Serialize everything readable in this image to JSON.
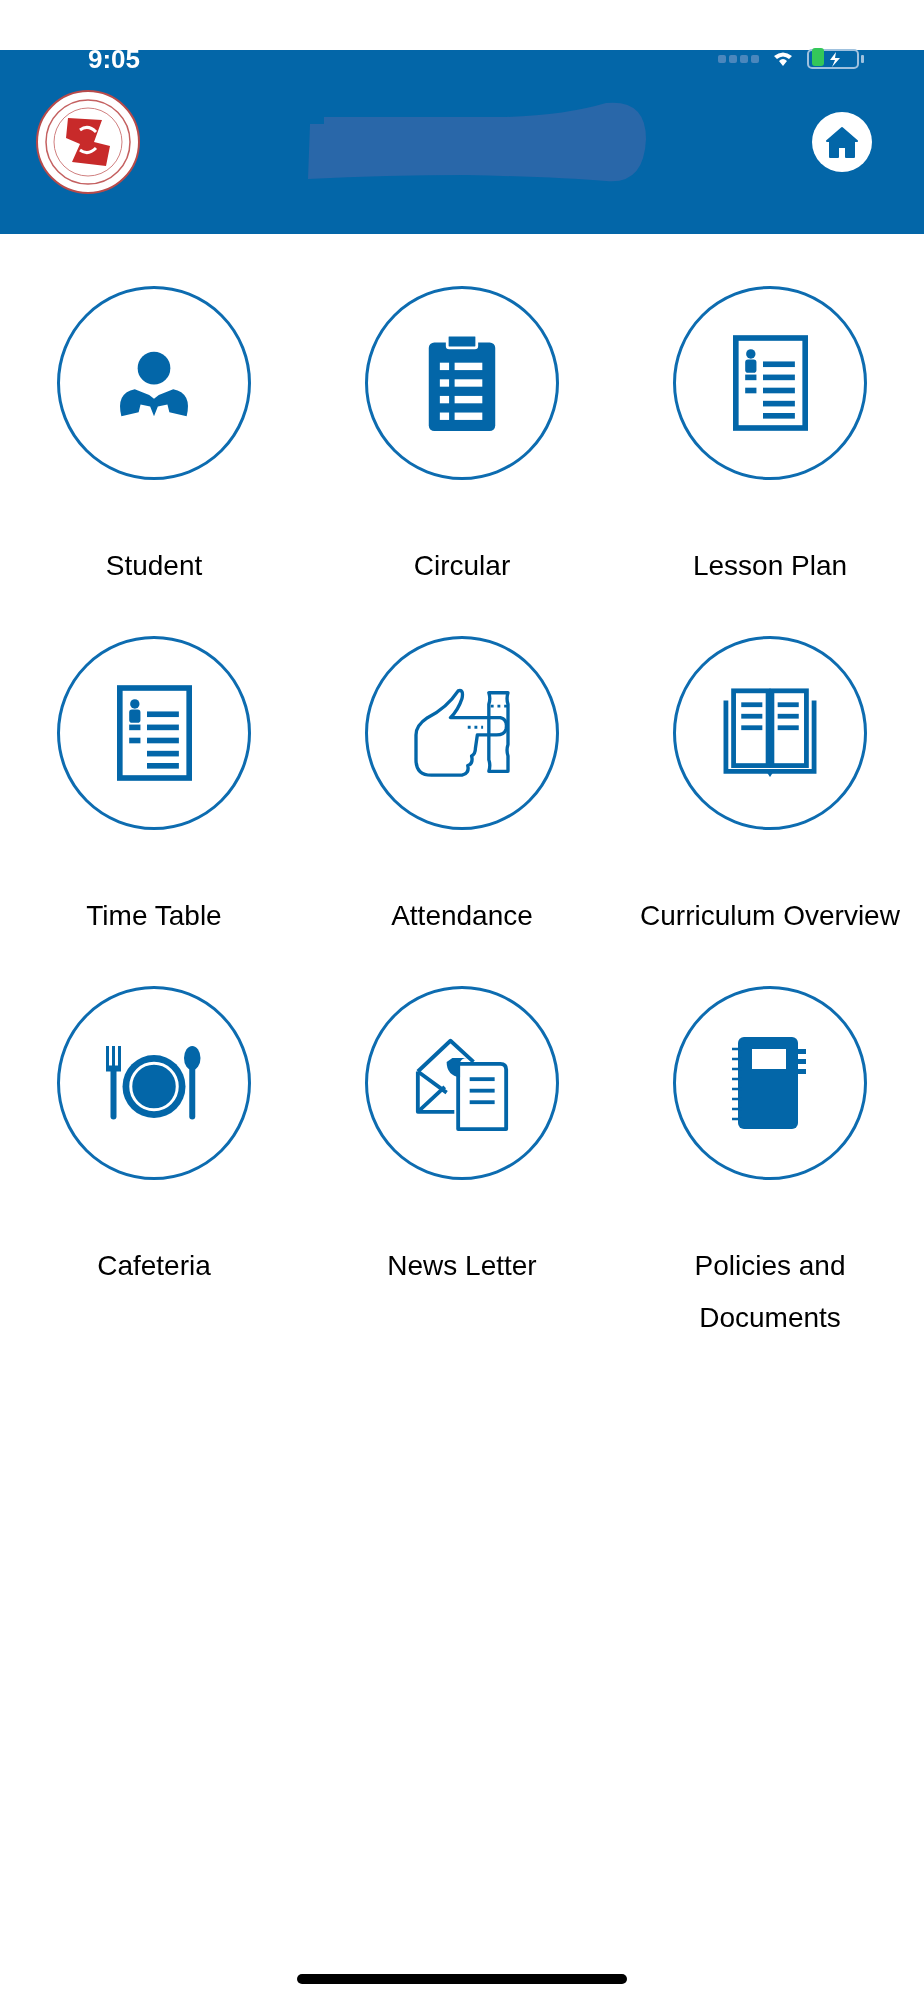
{
  "status_bar": {
    "time": "9:05"
  },
  "tiles": [
    {
      "kind": "student",
      "label": "Student"
    },
    {
      "kind": "clipboard",
      "label": "Circular"
    },
    {
      "kind": "document",
      "label": "Lesson Plan"
    },
    {
      "kind": "document",
      "label": "Time Table"
    },
    {
      "kind": "hand",
      "label": "Attendance"
    },
    {
      "kind": "book",
      "label": "Curriculum Overview"
    },
    {
      "kind": "dining",
      "label": "Cafeteria"
    },
    {
      "kind": "mail",
      "label": "News Letter"
    },
    {
      "kind": "notebook",
      "label": "Policies and Documents"
    }
  ]
}
